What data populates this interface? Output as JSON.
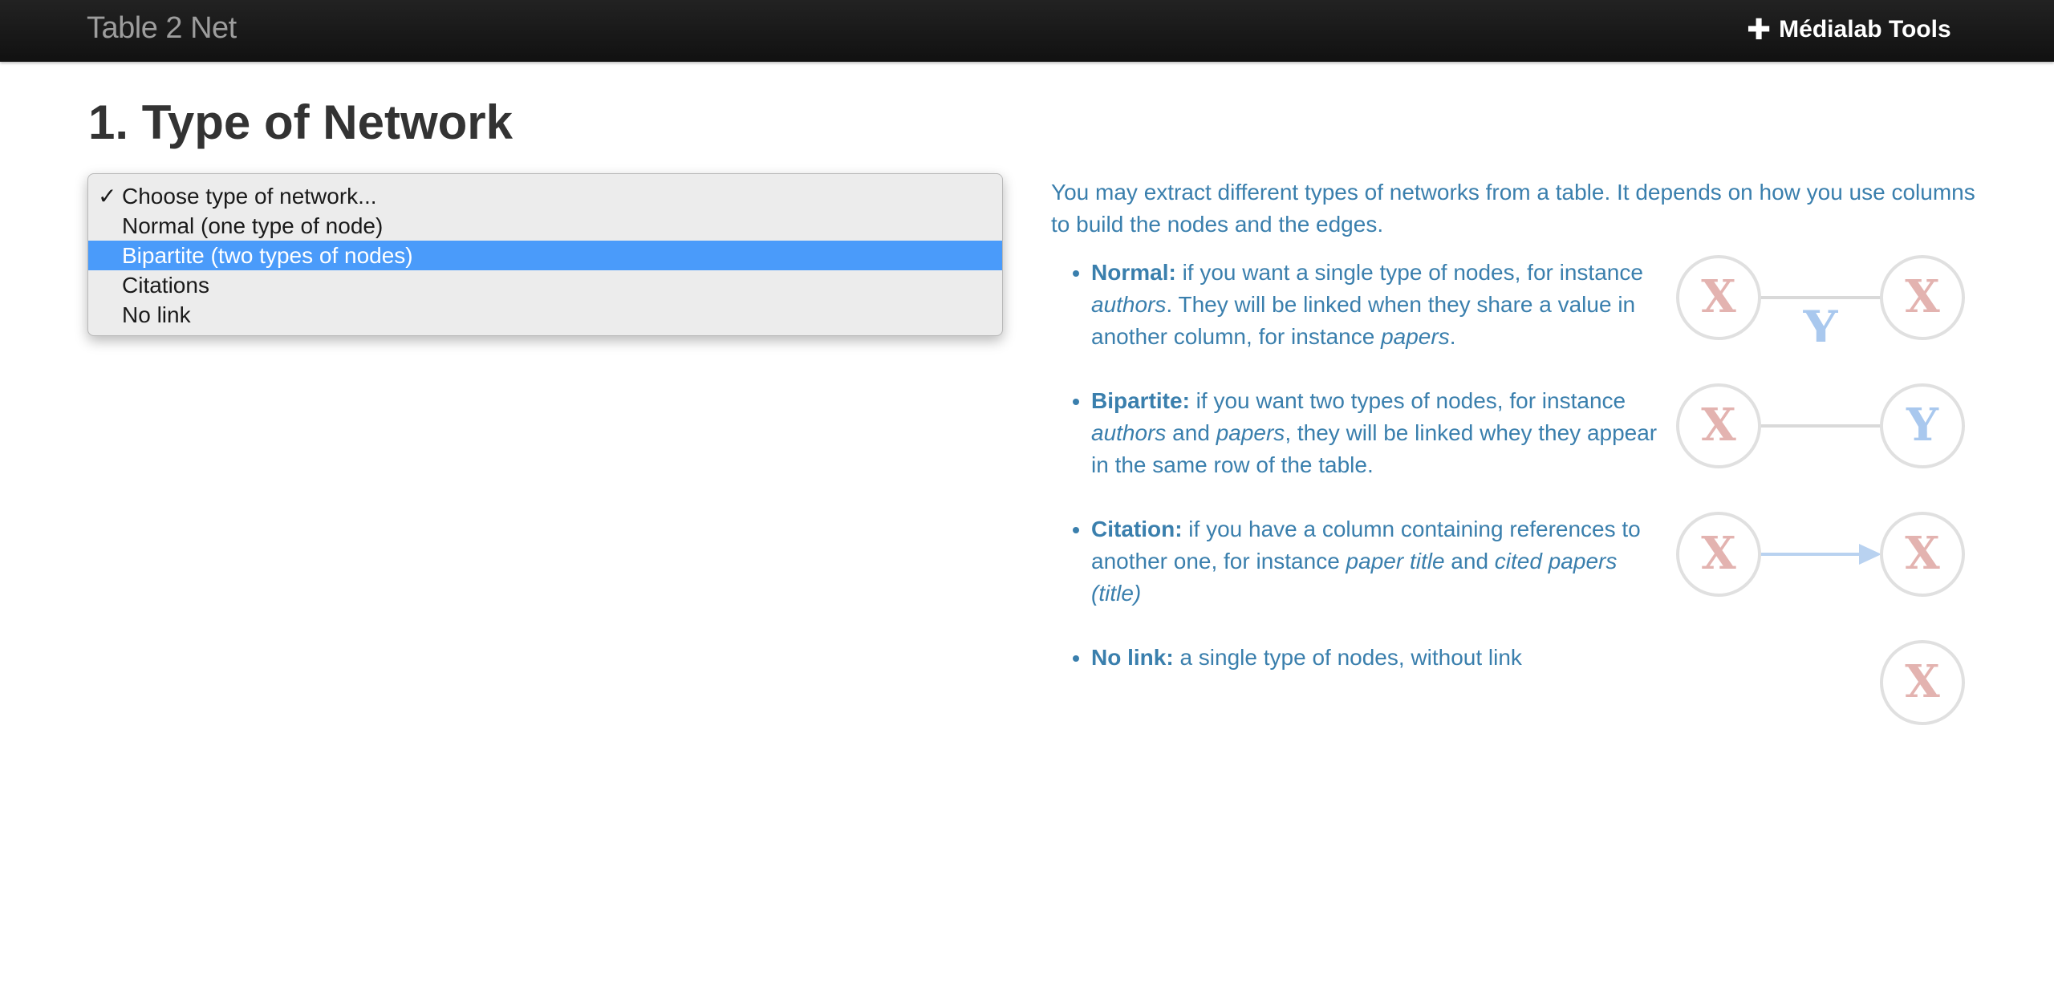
{
  "navbar": {
    "brand": "Table 2 Net",
    "tools_label": "Médialab Tools"
  },
  "page": {
    "title": "1. Type of Network"
  },
  "dropdown": {
    "options": [
      {
        "label": "Choose type of network...",
        "checked": true,
        "highlighted": false
      },
      {
        "label": "Normal (one type of node)",
        "checked": false,
        "highlighted": false
      },
      {
        "label": "Bipartite (two types of nodes)",
        "checked": false,
        "highlighted": true
      },
      {
        "label": "Citations",
        "checked": false,
        "highlighted": false
      },
      {
        "label": "No link",
        "checked": false,
        "highlighted": false
      }
    ],
    "check_mark": "✓"
  },
  "help": {
    "intro": "You may extract different types of networks from a table. It depends on how you use columns to build the nodes and the edges.",
    "items": [
      {
        "title": "Normal:",
        "t1": " if you want a single type of nodes, for instance ",
        "e1": "authors",
        "t2": ". They will be linked when they share a value in another column, for instance ",
        "e2": "papers",
        "t3": "."
      },
      {
        "title": "Bipartite:",
        "t1": " if you want two types of nodes, for instance ",
        "e1": "authors",
        "t2": " and ",
        "e2": "papers",
        "t3": ", they will be linked whey they appear in the same row of the table."
      },
      {
        "title": "Citation:",
        "t1": " if you have a column containing references to another one, for instance ",
        "e1": "paper title",
        "t2": " and ",
        "e2": "cited papers (title)",
        "t3": ""
      },
      {
        "title": "No link:",
        "t1": " a single type of nodes, without link",
        "e1": "",
        "t2": "",
        "e2": "",
        "t3": ""
      }
    ],
    "diagram_letters": {
      "x": "X",
      "y": "Y"
    }
  },
  "colors": {
    "navbar": "#1a1a1a",
    "accent_blue": "#4a9bfa",
    "help_text": "#3a7fad",
    "node_x": "#e3b3b0",
    "node_y": "#a9c8ee"
  }
}
